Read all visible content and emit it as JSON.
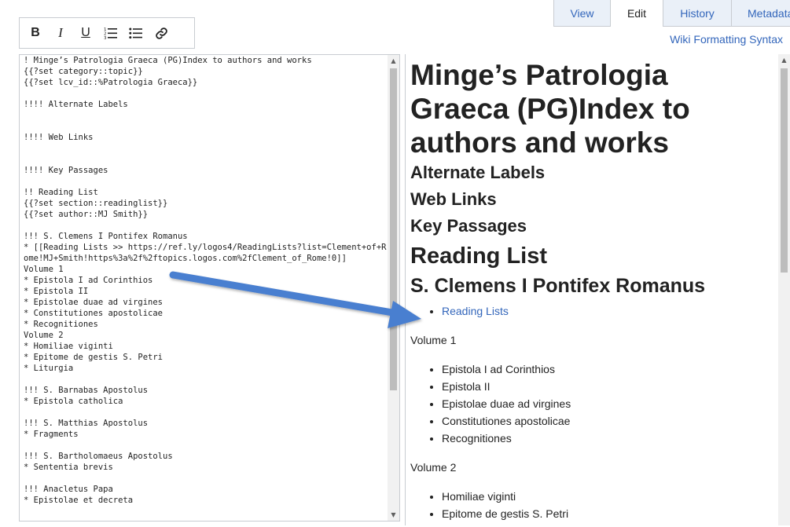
{
  "tabs": [
    {
      "label": "View",
      "active": false
    },
    {
      "label": "Edit",
      "active": true
    },
    {
      "label": "History",
      "active": false
    },
    {
      "label": "Metadata",
      "active": false
    }
  ],
  "syntax_link": "Wiki Formatting Syntax",
  "toolbar": {
    "bold": "B",
    "italic": "I",
    "underline": "U",
    "icons": [
      "ordered-list-icon",
      "bulleted-list-icon",
      "link-icon"
    ]
  },
  "editor": {
    "text": "! Minge’s Patrologia Graeca (PG)Index to authors and works\n{{?set category::topic}}\n{{?set lcv_id::%Patrologia Graeca}}\n\n!!!! Alternate Labels\n\n\n!!!! Web Links\n\n\n!!!! Key Passages\n\n!! Reading List\n{{?set section::readinglist}}\n{{?set author::MJ Smith}}\n\n!!! S. Clemens I Pontifex Romanus\n* [[Reading Lists >> https://ref.ly/logos4/ReadingLists?list=Clement+of+Rome!MJ+Smith!https%3a%2f%2ftopics.logos.com%2fClement_of_Rome!0]]\nVolume 1\n* Epistola I ad Corinthios\n* Epistola II\n* Epistolae duae ad virgines\n* Constitutiones apostolicae\n* Recognitiones\nVolume 2\n* Homiliae viginti\n* Epitome de gestis S. Petri\n* Liturgia\n\n!!! S. Barnabas Apostolus\n* Epistola catholica\n\n!!! S. Matthias Apostolus\n* Fragments\n\n!!! S. Bartholomaeus Apostolus\n* Sententia brevis\n\n!!! Anacletus Papa\n* Epistolae et decreta"
  },
  "preview": {
    "title": "Minge’s Patrologia Graeca (PG)Index to authors and works",
    "alternate_labels": "Alternate Labels",
    "web_links": "Web Links",
    "key_passages": "Key Passages",
    "reading_list": "Reading List",
    "section_heading": "S. Clemens I Pontifex Romanus",
    "reading_lists_link": "Reading Lists",
    "volume1": "Volume 1",
    "volume1_items": [
      "Epistola I ad Corinthios",
      "Epistola II",
      "Epistolae duae ad virgines",
      "Constitutiones apostolicae",
      "Recognitiones"
    ],
    "volume2": "Volume 2",
    "volume2_items": [
      "Homiliae viginti",
      "Epitome de gestis S. Petri"
    ]
  },
  "colors": {
    "link": "#3366bb",
    "tab_bg": "#eaf0f8",
    "border": "#c8ccd1",
    "arrow": "#4a7fd0"
  }
}
